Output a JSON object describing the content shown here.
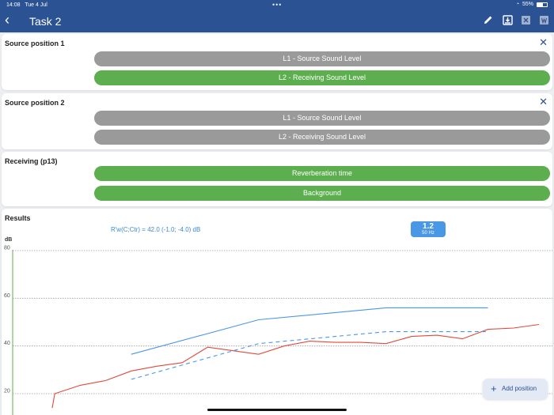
{
  "status": {
    "time": "14:08",
    "date": "Tue 4 Jul",
    "battery": "55%"
  },
  "header": {
    "title": "Task 2"
  },
  "toolbar": [
    "pencil-icon",
    "download-icon",
    "excel-icon",
    "word-icon"
  ],
  "sections": [
    {
      "title": "Source position 1",
      "closable": true,
      "buttons": [
        {
          "label": "L1 - Source Sound Level",
          "state": "gray"
        },
        {
          "label": "L2 - Receiving Sound Level",
          "state": "green"
        }
      ]
    },
    {
      "title": "Source position 2",
      "closable": true,
      "buttons": [
        {
          "label": "L1 - Source Sound Level",
          "state": "gray"
        },
        {
          "label": "L2 - Receiving Sound Level",
          "state": "gray"
        }
      ]
    },
    {
      "title": "Receiving (p13)",
      "closable": false,
      "buttons": [
        {
          "label": "Reverberation time",
          "state": "green"
        },
        {
          "label": "Background",
          "state": "green"
        }
      ]
    }
  ],
  "results": {
    "title": "Results",
    "rw_text": "R'w(C;Ctr) = 42.0 (-1.0; -4.0) dB",
    "badge_value": "1.2",
    "badge_unit": "50 Hz"
  },
  "colors": {
    "header": "#2b5292",
    "green": "#5cae4f",
    "gray": "#9a9a9a",
    "blue": "#4a97e6",
    "red": "#e04a3a"
  },
  "chart_data": {
    "type": "line",
    "ylabel": "dB",
    "yticks": [
      20,
      40,
      60,
      80
    ],
    "ylim": [
      15,
      82
    ],
    "xlim": [
      0,
      21
    ],
    "grid": true,
    "series": [
      {
        "style": "red-solid",
        "x": [
          0.9,
          1,
          2,
          3,
          4,
          5,
          6,
          7,
          8,
          9,
          10,
          11,
          12,
          13,
          14,
          15,
          16,
          17,
          18,
          19,
          20
        ],
        "values": [
          14,
          20,
          23.5,
          25.5,
          29.5,
          31.5,
          33,
          39.5,
          38,
          36.5,
          40,
          42,
          41.5,
          41.5,
          41,
          44,
          44.5,
          43,
          47,
          47.5,
          49
        ]
      },
      {
        "style": "blue-solid",
        "x": [
          4,
          9,
          14,
          18
        ],
        "values": [
          36.5,
          51,
          56,
          56
        ]
      },
      {
        "style": "blue-dashed",
        "x": [
          4,
          9,
          14,
          18
        ],
        "values": [
          26,
          41,
          46,
          46
        ]
      }
    ]
  },
  "add_button": {
    "label": "Add position"
  }
}
